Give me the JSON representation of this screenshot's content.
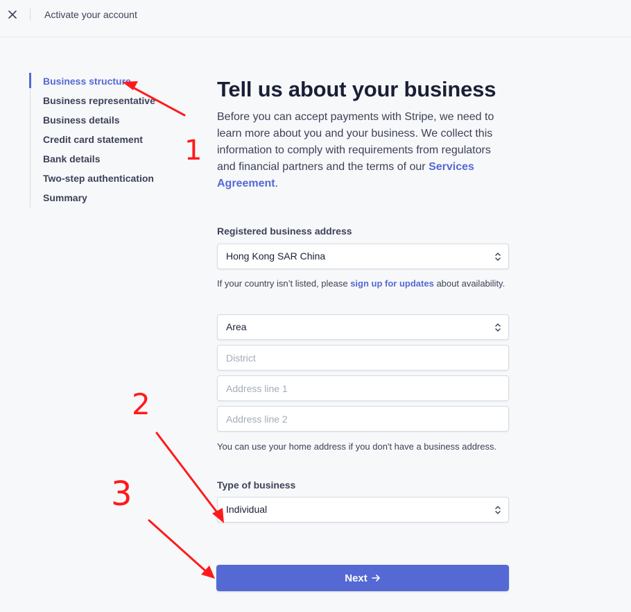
{
  "topbar": {
    "title": "Activate your account",
    "close_icon": "close-icon"
  },
  "sidebar": {
    "items": [
      {
        "label": "Business structure",
        "active": true
      },
      {
        "label": "Business representative",
        "active": false
      },
      {
        "label": "Business details",
        "active": false
      },
      {
        "label": "Credit card statement",
        "active": false
      },
      {
        "label": "Bank details",
        "active": false
      },
      {
        "label": "Two-step authentication",
        "active": false
      },
      {
        "label": "Summary",
        "active": false
      }
    ]
  },
  "main": {
    "title": "Tell us about your business",
    "intro_text": "Before you can accept payments with Stripe, we need to learn more about you and your business. We collect this information to comply with requirements from regulators and financial partners and the terms of our ",
    "intro_link": "Services Agreement",
    "intro_end": ".",
    "address": {
      "label": "Registered business address",
      "country_value": "Hong Kong SAR China",
      "hint_prefix": "If your country isn’t listed, please ",
      "hint_link": "sign up for updates",
      "hint_suffix": " about availability.",
      "area_value": "Area",
      "district_placeholder": "District",
      "line1_placeholder": "Address line 1",
      "line2_placeholder": "Address line 2",
      "home_hint": "You can use your home address if you don't have a business address."
    },
    "business_type": {
      "label": "Type of business",
      "value": "Individual"
    },
    "next_button": {
      "label": "Next",
      "icon": "arrow-right-icon"
    }
  },
  "annotations": {
    "labels": [
      "1",
      "2",
      "3"
    ],
    "color": "#ff1a1a"
  },
  "colors": {
    "accent": "#5469d4",
    "text": "#3c4257",
    "heading": "#1a1f36",
    "annotation": "#ff1a1a"
  }
}
